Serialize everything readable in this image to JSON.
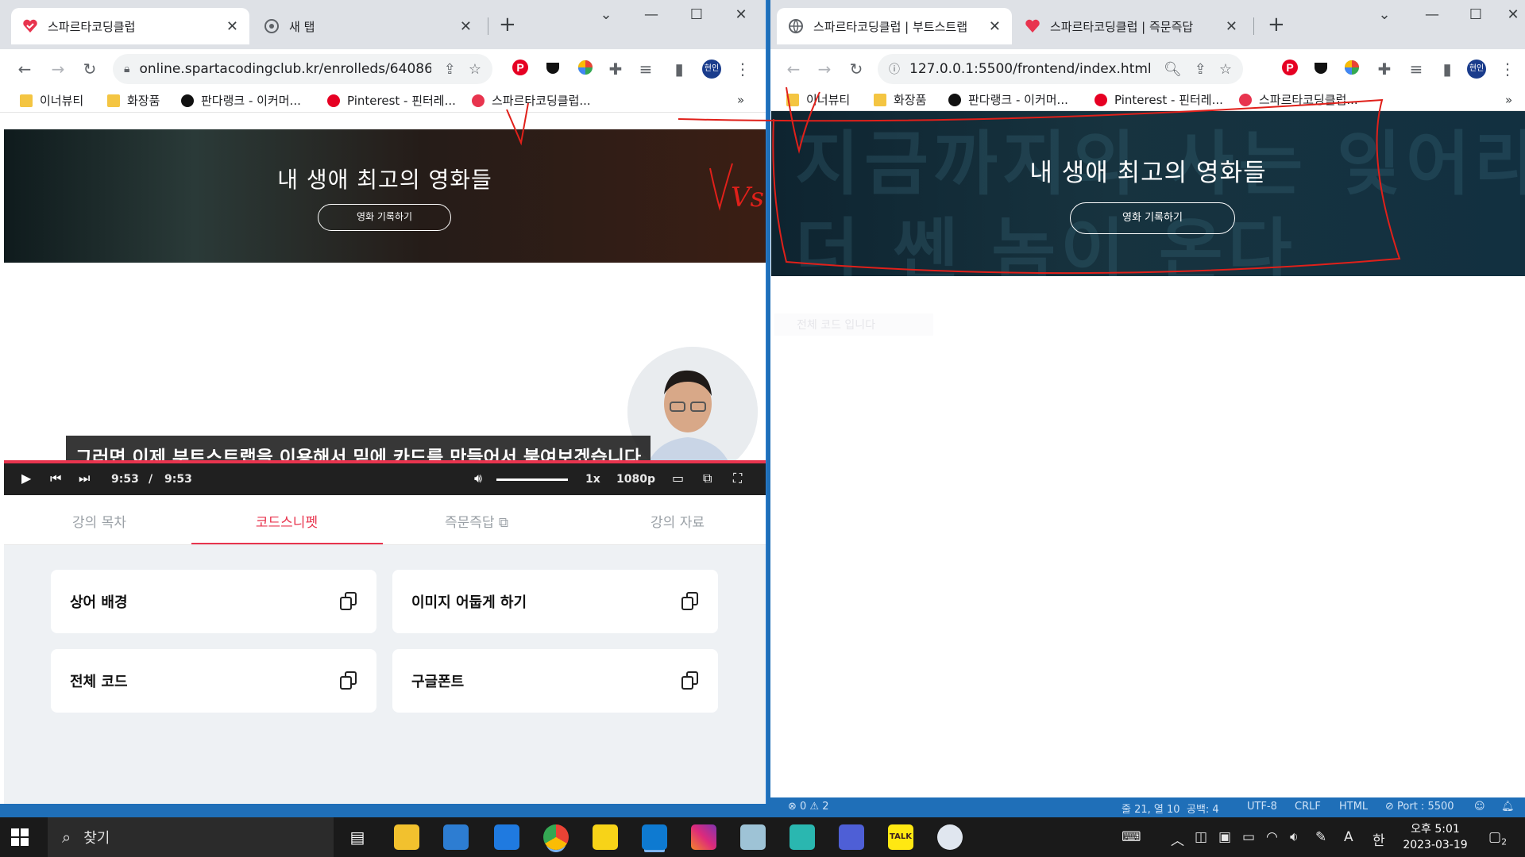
{
  "left_window": {
    "tabs": [
      {
        "title": "스파르타코딩클럽",
        "active": true
      },
      {
        "title": "새 탭",
        "active": false
      }
    ],
    "address": "online.spartacodingclub.kr/enrolleds/64086...",
    "bookmarks": [
      "이너뷰티",
      "화장품",
      "판다랭크 - 이커머...",
      "Pinterest - 핀터레...",
      "스파르타코딩클럽..."
    ],
    "bookmarks_more": "»",
    "hero": {
      "title": "내 생애 최고의 영화들",
      "button": "영화 기록하기"
    },
    "video": {
      "subtitle": "그러면 이제 부트스트랩을 이용해서 밑에 카드를 만들어서 붙여보겠습니다",
      "current_time": "9:53",
      "time_separator": "/",
      "duration": "9:53",
      "speed": "1x",
      "quality": "1080p",
      "progress": 1.0
    },
    "lecture_tabs": [
      {
        "label": "강의 목차",
        "active": false
      },
      {
        "label": "코드스니펫",
        "active": true
      },
      {
        "label": "즉문즉답",
        "active": false
      },
      {
        "label": "강의 자료",
        "active": false
      }
    ],
    "snippets": [
      "상어 배경",
      "이미지 어둡게 하기",
      "전체 코드",
      "구글폰트"
    ]
  },
  "right_window": {
    "tabs": [
      {
        "title": "스파르타코딩클럽 | 부트스트랩",
        "active": true
      },
      {
        "title": "스파르타코딩클럽 | 즉문즉답",
        "active": false
      }
    ],
    "address": "127.0.0.1:5500/frontend/index.html",
    "bookmarks": [
      "이너뷰티",
      "화장품",
      "판다랭크 - 이커머...",
      "Pinterest - 핀터레...",
      "스파르타코딩클럽..."
    ],
    "bookmarks_more": "»",
    "hero": {
      "title": "내 생애 최고의 영화들",
      "button": "영화 기록하기",
      "background_text_line1": "지금까지의 사는 잊어라",
      "background_text_line2": "더 쎈 놈이 온다"
    },
    "faint_text": "전체 코드 입니다"
  },
  "vscode_status": {
    "problems": "⊗ 0 ⚠ 2",
    "position": "줄 21, 열 10",
    "spaces": "공백: 4",
    "encoding": "UTF-8",
    "eol": "CRLF",
    "language": "HTML",
    "port": "⊘ Port : 5500"
  },
  "annotation": {
    "label": "Vs",
    "color": "#e0201a"
  },
  "taskbar": {
    "search_placeholder": "찾기",
    "clock_time": "오후 5:01",
    "clock_date": "2023-03-19",
    "ime_mode": "A",
    "ime_lang": "한",
    "notification_count": "2"
  },
  "colors": {
    "brand_red": "#e8344e",
    "chrome_tabstrip": "#dee1e6",
    "snippet_bg": "#eef1f4"
  }
}
